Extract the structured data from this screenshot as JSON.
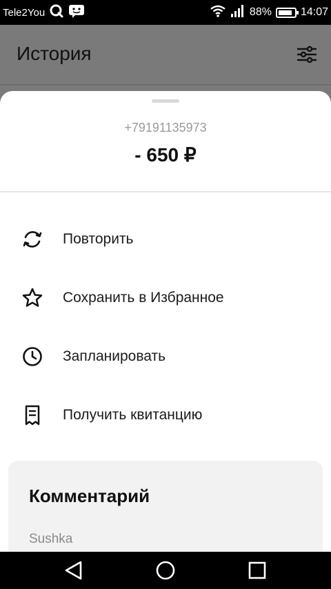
{
  "status_bar": {
    "carrier": "Tele2You",
    "battery_percent": "88%",
    "battery_level": 0.88,
    "time": "14:07"
  },
  "app_bar": {
    "title": "История"
  },
  "sheet": {
    "phone": "+79191135973",
    "amount": "- 650 ₽",
    "actions": [
      {
        "label": "Повторить",
        "icon": "refresh-icon"
      },
      {
        "label": "Сохранить в Избранное",
        "icon": "star-icon"
      },
      {
        "label": "Запланировать",
        "icon": "clock-icon"
      },
      {
        "label": "Получить квитанцию",
        "icon": "receipt-icon"
      }
    ]
  },
  "comment": {
    "title": "Комментарий",
    "text": "Sushka"
  },
  "colors": {
    "overlay": "#7a7a7a",
    "sheet_bg": "#ffffff",
    "card_bg": "#f2f2f2",
    "muted_text": "#9a9a9a"
  }
}
